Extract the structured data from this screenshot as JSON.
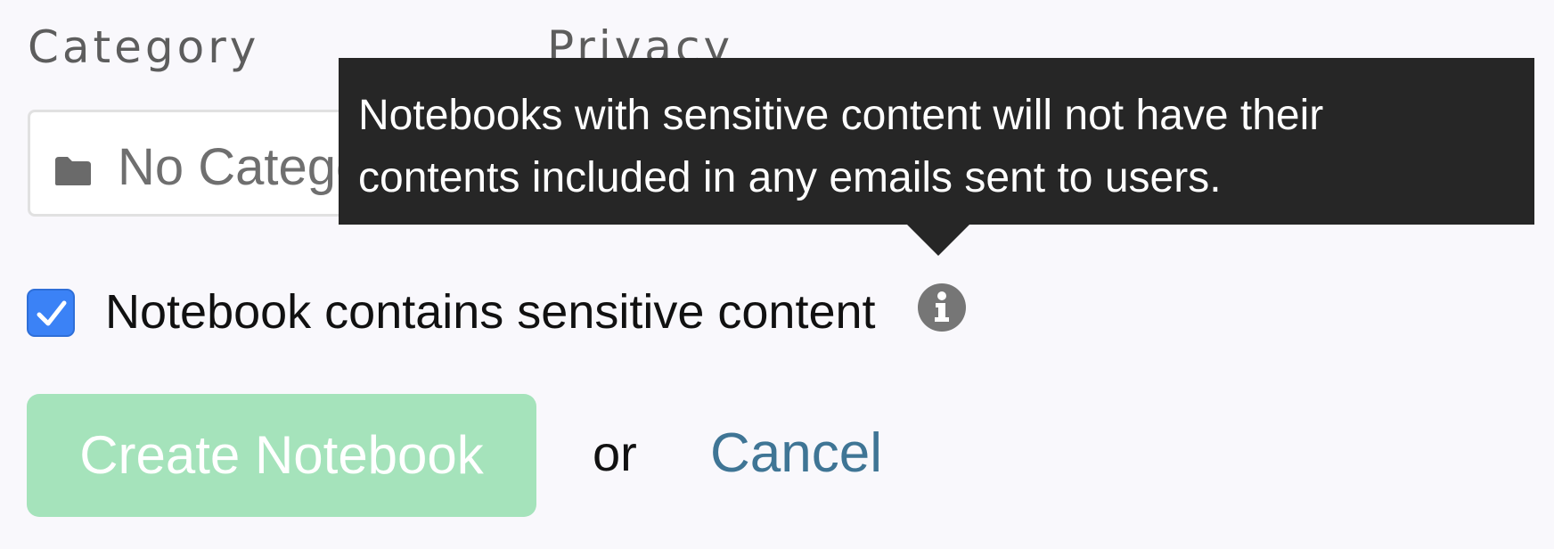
{
  "form": {
    "category_label": "Category",
    "privacy_label": "Privacy",
    "category_value": "No Category",
    "sensitive_checkbox": {
      "label": "Notebook contains sensitive content",
      "checked": true
    },
    "create_button_label": "Create Notebook",
    "or_text": "or",
    "cancel_label": "Cancel"
  },
  "tooltip": {
    "lines": [
      "Notebooks with sensitive content will not have their",
      "contents included in any emails sent to users."
    ]
  },
  "icons": {
    "category": "folder-icon",
    "info": "info-icon",
    "check": "checkmark-icon"
  },
  "colors": {
    "primary_button_disabled": "#a5e3bb",
    "link": "#3f7595",
    "checkbox": "#3b82f6",
    "tooltip_bg": "#262626",
    "background": "#f9f8fc"
  }
}
